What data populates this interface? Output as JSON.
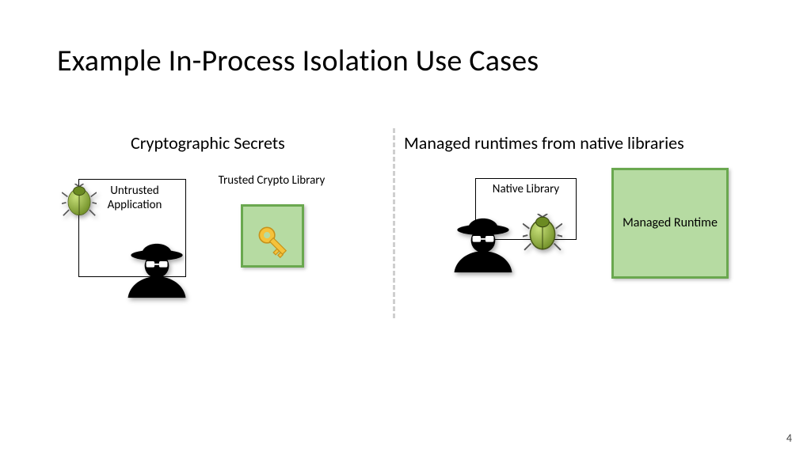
{
  "title": "Example In-Process Isolation Use Cases",
  "left": {
    "heading": "Cryptographic Secrets",
    "untrusted_label": "Untrusted Application",
    "trusted_label": "Trusted Crypto Library"
  },
  "right": {
    "heading": "Managed runtimes from native libraries",
    "native_label": "Native Library",
    "managed_label": "Managed Runtime"
  },
  "page_number": "4",
  "icons": {
    "bug": "bug-icon",
    "spy": "spy-icon",
    "key": "key-icon"
  },
  "colors": {
    "trusted_fill": "#b6dba2",
    "trusted_border": "#6aa84f"
  }
}
